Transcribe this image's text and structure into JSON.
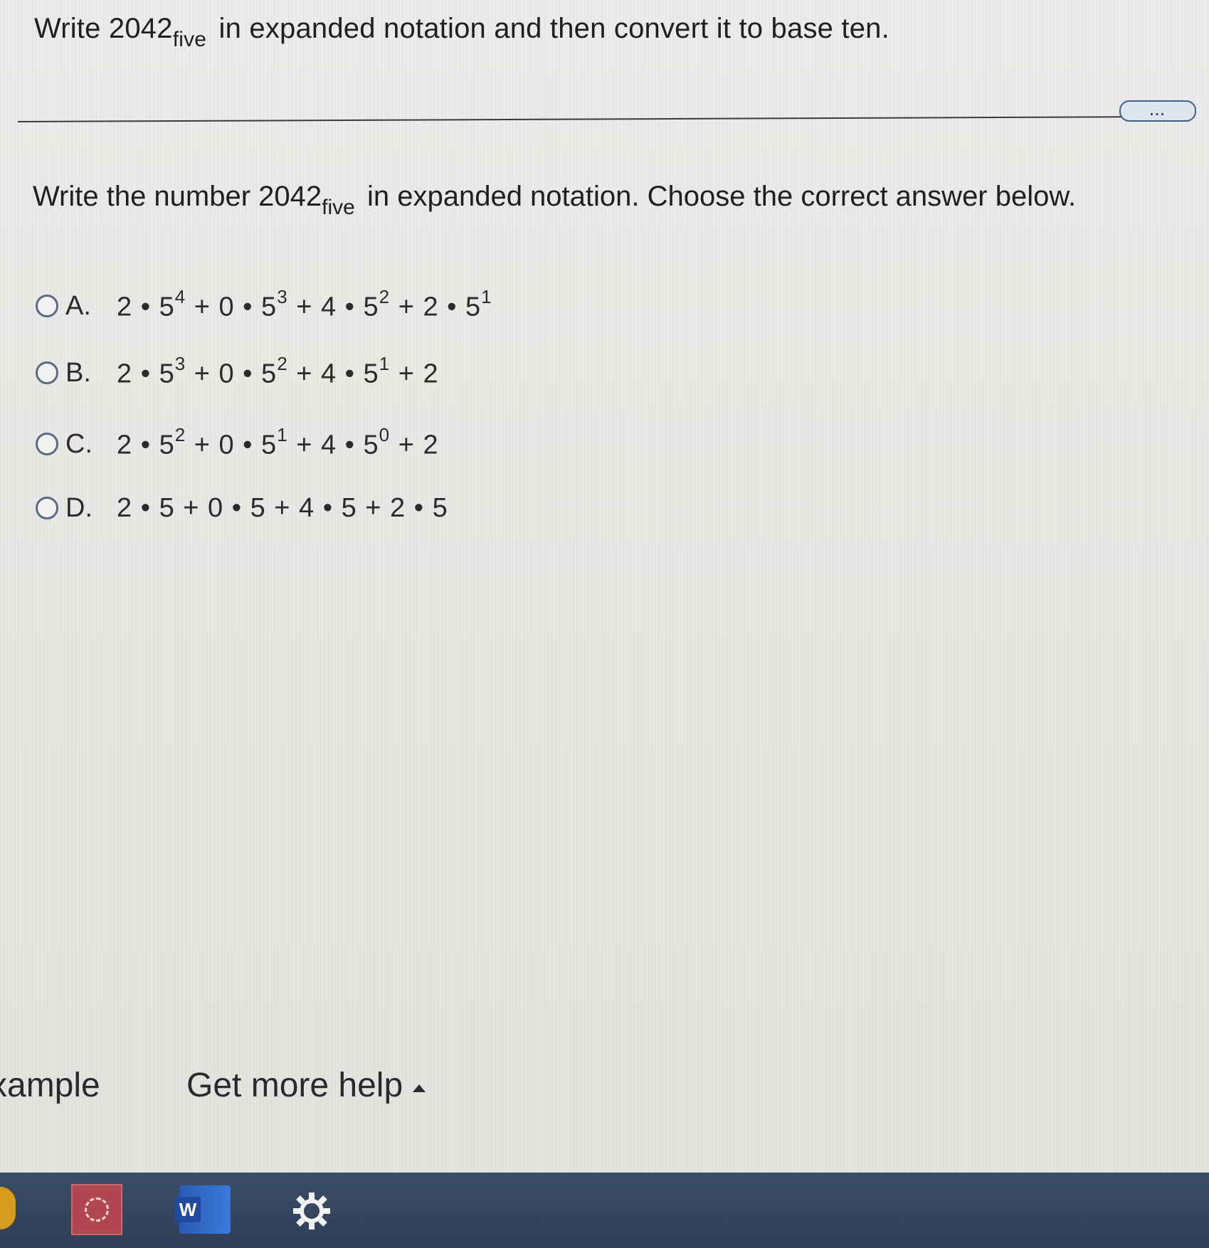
{
  "header": {
    "instruction_prefix": "Write 2042",
    "instruction_sub": "five",
    "instruction_suffix": "in expanded notation and then convert it to base ten.",
    "more_label": "..."
  },
  "question": {
    "prefix": "Write the number 2042",
    "sub": "five",
    "suffix": "in expanded notation. Choose the correct answer below."
  },
  "options": [
    {
      "letter": "A.",
      "terms": [
        {
          "coef": "2",
          "base": "5",
          "exp": "4"
        },
        {
          "coef": "0",
          "base": "5",
          "exp": "3"
        },
        {
          "coef": "4",
          "base": "5",
          "exp": "2"
        },
        {
          "coef": "2",
          "base": "5",
          "exp": "1"
        }
      ]
    },
    {
      "letter": "B.",
      "terms": [
        {
          "coef": "2",
          "base": "5",
          "exp": "3"
        },
        {
          "coef": "0",
          "base": "5",
          "exp": "2"
        },
        {
          "coef": "4",
          "base": "5",
          "exp": "1"
        },
        {
          "coef": "2",
          "base": "",
          "exp": ""
        }
      ]
    },
    {
      "letter": "C.",
      "terms": [
        {
          "coef": "2",
          "base": "5",
          "exp": "2"
        },
        {
          "coef": "0",
          "base": "5",
          "exp": "1"
        },
        {
          "coef": "4",
          "base": "5",
          "exp": "0"
        },
        {
          "coef": "2",
          "base": "",
          "exp": ""
        }
      ]
    },
    {
      "letter": "D.",
      "terms": [
        {
          "coef": "2",
          "base": "5",
          "exp": ""
        },
        {
          "coef": "0",
          "base": "5",
          "exp": ""
        },
        {
          "coef": "4",
          "base": "5",
          "exp": ""
        },
        {
          "coef": "2",
          "base": "5",
          "exp": ""
        }
      ]
    }
  ],
  "footer": {
    "example_label": "xample",
    "help_label": "Get more help"
  },
  "taskbar": {
    "word_letter": "W",
    "icons": [
      "app-icon",
      "word-icon",
      "settings-gear-icon"
    ]
  }
}
